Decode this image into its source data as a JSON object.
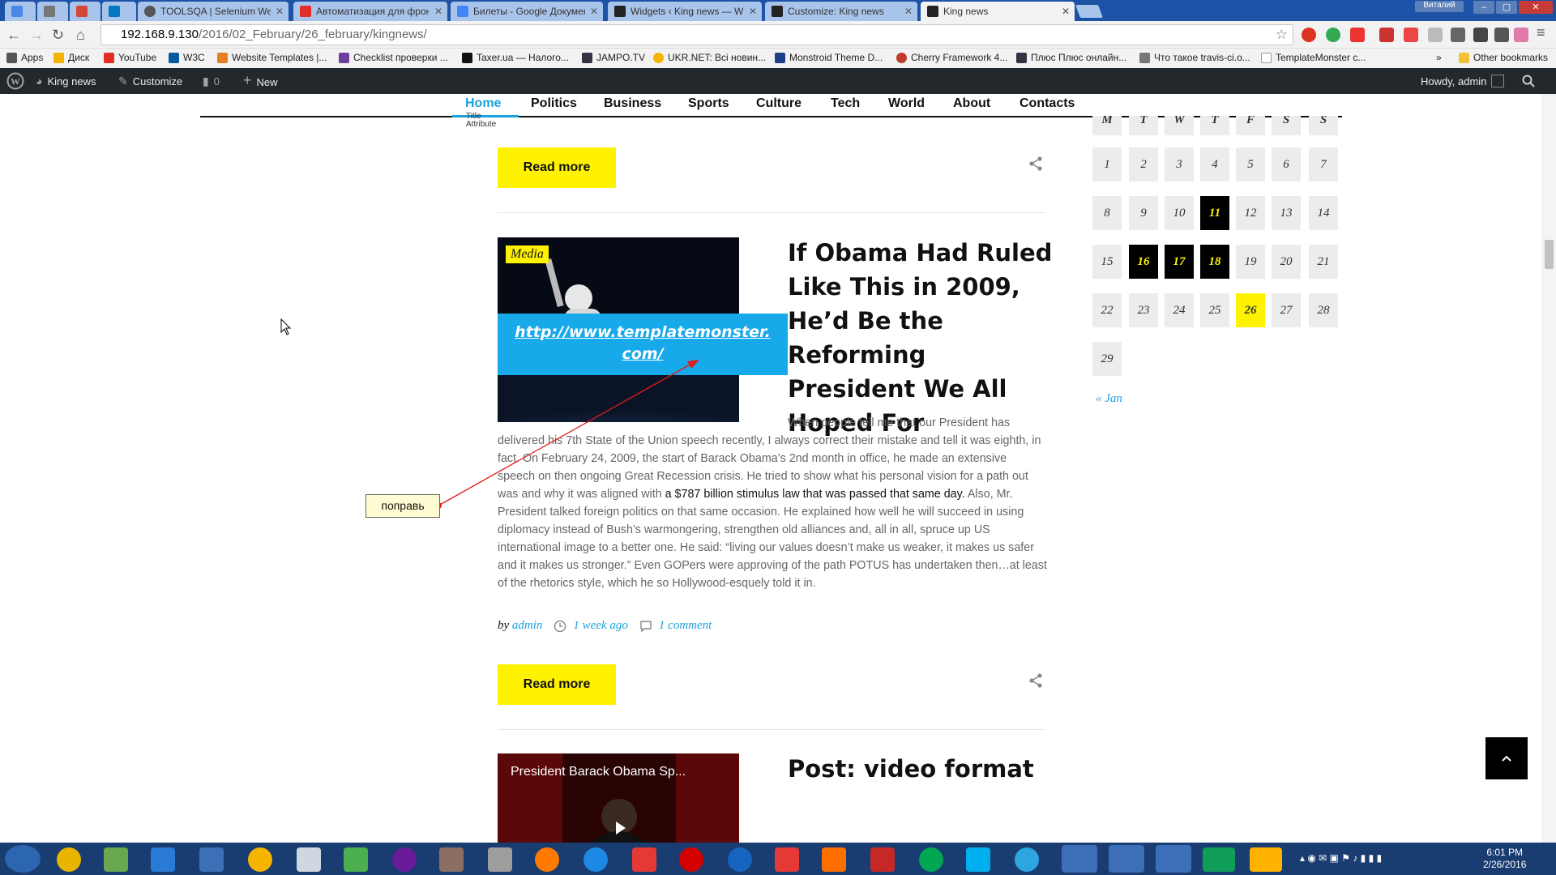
{
  "browser": {
    "tabs": [
      {
        "title": "",
        "color": "#4a88e8"
      },
      {
        "title": "",
        "color": "#777"
      },
      {
        "title": "",
        "color": "#d44638"
      },
      {
        "title": "",
        "color": "#0079bf"
      },
      {
        "title": "TOOLSQA | Selenium Web",
        "color": "#555"
      },
      {
        "title": "Автоматизация для фрон",
        "color": "#e52d27"
      },
      {
        "title": "Билеты - Google Докумен",
        "color": "#4285f4"
      },
      {
        "title": "Widgets ‹ King news — W",
        "color": "#222"
      },
      {
        "title": "Customize: King news",
        "color": "#222"
      },
      {
        "title": "King news",
        "color": "#222"
      }
    ],
    "active_tab": 9,
    "user_badge": "Виталий",
    "url_host": "192.168.9.130",
    "url_path": "/2016/02_February/26_february/kingnews/"
  },
  "bookmarks": {
    "items": [
      {
        "label": "Apps",
        "color": "#555"
      },
      {
        "label": "Диск",
        "color": "#f4b400"
      },
      {
        "label": "YouTube",
        "color": "#e52d27"
      },
      {
        "label": "W3C",
        "color": "#005a9c"
      },
      {
        "label": "Website Templates |...",
        "color": "#e67e22"
      },
      {
        "label": "Checklist проверки ...",
        "color": "#6a3fa0"
      },
      {
        "label": "Taxer.ua — Налого...",
        "color": "#111"
      },
      {
        "label": "JAMPO.TV",
        "color": "#334"
      },
      {
        "label": "UKR.NET: Всі новин...",
        "color": "#f5b400"
      },
      {
        "label": "Monstroid Theme D...",
        "color": "#1e3f8a"
      },
      {
        "label": "Cherry Framework 4...",
        "color": "#c0392b"
      },
      {
        "label": "Плюс Плюс онлайн...",
        "color": "#334"
      },
      {
        "label": "Что такое travis-ci.o...",
        "color": "#777"
      },
      {
        "label": "TemplateMonster c...",
        "color": "#999"
      }
    ],
    "overflow": "»",
    "other": "Other bookmarks"
  },
  "admin_bar": {
    "site": "King news",
    "customize": "Customize",
    "comments": "0",
    "new": "New",
    "howdy": "Howdy, admin"
  },
  "nav": {
    "items": [
      "Home",
      "Politics",
      "Business",
      "Sports",
      "Culture",
      "Tech",
      "World",
      "About",
      "Contacts"
    ],
    "active": 0,
    "tooltip_line1": "Title",
    "tooltip_line2": "Attribute"
  },
  "post": {
    "read_more": "Read more",
    "badge": "Media",
    "link": "http://www.templatemonster.com/",
    "link_line1": "http://www.templatemonster.",
    "link_line2": "com/",
    "title": "If Obama Had Ruled Like This in 2009, He’d Be the Reforming President We All Hoped For",
    "excerpt_first": "When people tell me that our President has",
    "excerpt_a": "delivered his 7th State of the Union speech recently, I always correct their mistake and tell it was eighth, in fact. On February 24, 2009, the start of Barack Obama’s 2nd month in office, he made an extensive speech on then ongoing Great Recession crisis. He tried to show what his personal vision for a path out was and why it was aligned with ",
    "excerpt_link": "a $787 billion stimulus law that was passed that same day.",
    "excerpt_b": " Also, Mr. President talked foreign politics on that same occasion. He explained how well he will succeed in using diplomacy instead of Bush’s warmongering, strengthen old alliances and, all in all, spruce up US international image to a better one. He said: “living our values doesn’t make us weaker, it makes us safer and it makes us stronger.” Even GOPers were approving of the path POTUS has undertaken then…at least of the rhetorics style, which he so Hollywood-esquely told it in.",
    "by": "by",
    "author": "admin",
    "date": "1 week ago",
    "comments": "1 comment"
  },
  "post2": {
    "video_title": "President Barack Obama Sp...",
    "title": "Post: video format"
  },
  "calendar": {
    "header": [
      "M",
      "T",
      "W",
      "T",
      "F",
      "S",
      "S"
    ],
    "days": [
      [
        "1",
        "2",
        "3",
        "4",
        "5",
        "6",
        "7"
      ],
      [
        "8",
        "9",
        "10",
        "11",
        "12",
        "13",
        "14"
      ],
      [
        "15",
        "16",
        "17",
        "18",
        "19",
        "20",
        "21"
      ],
      [
        "22",
        "23",
        "24",
        "25",
        "26",
        "27",
        "28"
      ],
      [
        "29"
      ]
    ],
    "has_posts": [
      "11",
      "16",
      "17",
      "18"
    ],
    "today": "26",
    "prev": "« Jan"
  },
  "annotation": {
    "note": "поправь",
    "color": "#e01b1b"
  },
  "taskbar": {
    "time": "6:01 PM",
    "date": "2/26/2016"
  },
  "colors": {
    "accent": "#1aa1de",
    "yellow": "#fef200",
    "link_box": "#18a9eb"
  }
}
